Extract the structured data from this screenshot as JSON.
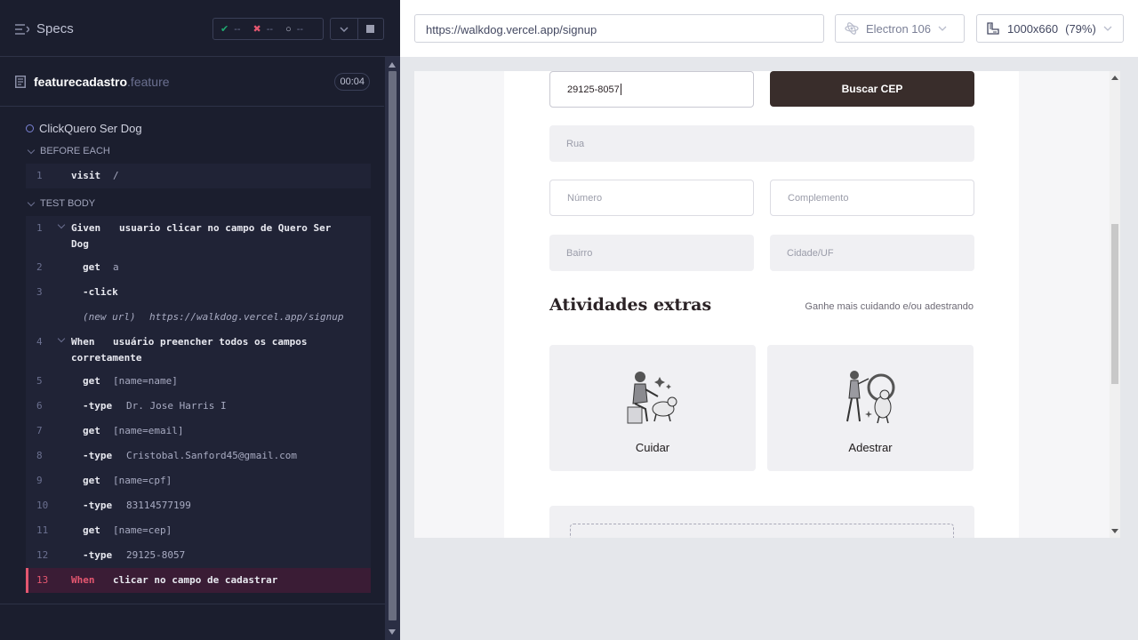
{
  "header": {
    "specs_label": "Specs",
    "passed": "--",
    "failed": "--",
    "pending": "--"
  },
  "file": {
    "name": "featurecadastro",
    "ext": ".feature",
    "duration": "00:04"
  },
  "suite": {
    "title": "ClickQuero Ser Dog"
  },
  "sections": {
    "before_each": "BEFORE EACH",
    "test_body": "TEST BODY"
  },
  "before": [
    {
      "n": "1",
      "cmd": "visit",
      "arg": "/"
    }
  ],
  "steps": [
    {
      "n": "1",
      "cmd": "Given",
      "arg": "usuario clicar no campo de Quero Ser",
      "arg2": "Dog"
    },
    {
      "n": "2",
      "cmd": "get",
      "arg": "a"
    },
    {
      "n": "3",
      "cmd": "-click",
      "arg": ""
    },
    {
      "n": "",
      "cmd": "(new url)",
      "arg": "https://walkdog.vercel.app/signup"
    },
    {
      "n": "4",
      "cmd": "When",
      "arg": "usuário preencher todos os campos",
      "arg2": "corretamente"
    },
    {
      "n": "5",
      "cmd": "get",
      "arg": "[name=name]"
    },
    {
      "n": "6",
      "cmd": "-type",
      "arg": "Dr. Jose Harris I"
    },
    {
      "n": "7",
      "cmd": "get",
      "arg": "[name=email]"
    },
    {
      "n": "8",
      "cmd": "-type",
      "arg": "Cristobal.Sanford45@gmail.com"
    },
    {
      "n": "9",
      "cmd": "get",
      "arg": "[name=cpf]"
    },
    {
      "n": "10",
      "cmd": "-type",
      "arg": "83114577199"
    },
    {
      "n": "11",
      "cmd": "get",
      "arg": "[name=cep]"
    },
    {
      "n": "12",
      "cmd": "-type",
      "arg": "29125-8057"
    },
    {
      "n": "13",
      "cmd": "When",
      "arg": "clicar no campo de cadastrar"
    }
  ],
  "browser": {
    "url": "https://walkdog.vercel.app/signup",
    "engine": "Electron 106",
    "size": "1000x660",
    "zoom": "(79%)"
  },
  "form": {
    "cep_value": "29125-8057",
    "buscar": "Buscar CEP",
    "rua": "Rua",
    "numero": "Número",
    "complemento": "Complemento",
    "bairro": "Bairro",
    "cidade": "Cidade/UF",
    "extras_title": "Atividades extras",
    "extras_hint": "Ganhe mais cuidando e/ou adestrando",
    "opt1": "Cuidar",
    "opt2": "Adestrar"
  }
}
